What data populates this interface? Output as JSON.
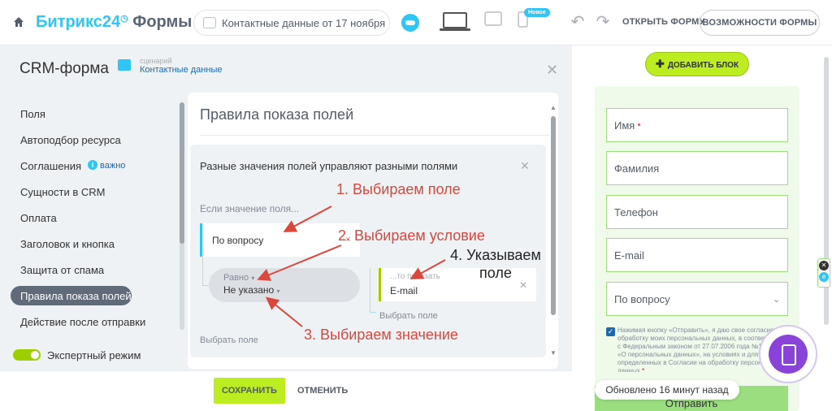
{
  "header": {
    "logo_main": "Битрикс24",
    "logo_sub": "Формы",
    "document_title": "Контактные данные от 17 ноября",
    "new_badge": "Новое",
    "open_form": "ОТКРЫТЬ ФОРМУ",
    "features": "ВОЗМОЖНОСТИ ФОРМЫ"
  },
  "sidebar": {
    "title": "CRM-форма",
    "scenario_label": "сценарий",
    "scenario_value": "Контактные данные",
    "items": [
      {
        "label": "Поля"
      },
      {
        "label": "Автоподбор ресурса"
      },
      {
        "label": "Соглашения"
      },
      {
        "label": "Сущности в CRM"
      },
      {
        "label": "Оплата"
      },
      {
        "label": "Заголовок и кнопка"
      },
      {
        "label": "Защита от спама"
      },
      {
        "label": "Правила показа полей"
      },
      {
        "label": "Действие после отправки"
      }
    ],
    "important_label": "важно",
    "expert_mode": "Экспертный режим"
  },
  "panel": {
    "title": "Правила показа полей",
    "rule_title": "Разные значения полей управляют разными полями",
    "if_label": "Если значение поля...",
    "field_value": "По вопросу",
    "operator": "Равно",
    "condition_value": "Не указано",
    "target_label": "...то показать",
    "target_value": "E-mail",
    "select_field": "Выбрать поле"
  },
  "annotations": {
    "step1": "1. Выбираем поле",
    "step2": "2. Выбираем условие",
    "step3": "3. Выбираем значение",
    "step4_line1": "4. Указываем",
    "step4_line2": "поле"
  },
  "footer": {
    "save": "СОХРАНИТЬ",
    "cancel": "ОТМЕНИТЬ"
  },
  "preview": {
    "add_block": "ДОБАВИТЬ БЛОК",
    "fields": [
      {
        "label": "Имя",
        "required": "*"
      },
      {
        "label": "Фамилия"
      },
      {
        "label": "Телефон"
      },
      {
        "label": "E-mail"
      },
      {
        "label": "По вопросу"
      }
    ],
    "consent_text": "Нажимая кнопку «Отправить», я даю свое согласие на обработку моих персональных данных, в соответствии с Федеральным законом от 27.07.2006 года №152-ФЗ «О персональных данных», на условиях и для целей, определенных в Согласии на обработку персональных данных",
    "consent_required": "*",
    "updated": "Обновлено 16 минут назад",
    "submit": "Отправить"
  },
  "colors": {
    "accent_blue": "#2fc6f6",
    "accent_green": "#bbed21",
    "annotation_red": "#d9473d",
    "active_item": "#5f6b78",
    "purple": "#8a43d8"
  }
}
